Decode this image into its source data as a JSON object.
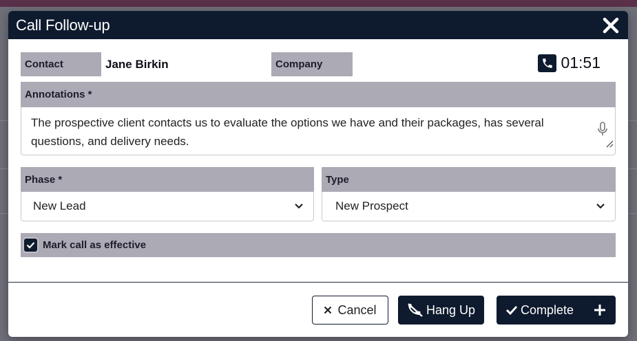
{
  "dialog": {
    "title": "Call Follow-up",
    "close_icon": "close-icon"
  },
  "contact": {
    "label": "Contact",
    "value": "Jane Birkin"
  },
  "company": {
    "label": "Company",
    "value": ""
  },
  "timer": {
    "icon": "phone-icon",
    "value": "01:51"
  },
  "annotations": {
    "label": "Annotations *",
    "value": "The prospective client contacts us to evaluate the options we have and their packages, has several questions, and delivery needs.",
    "mic_icon": "microphone-icon"
  },
  "phase": {
    "label": "Phase *",
    "selected": "New Lead"
  },
  "type": {
    "label": "Type",
    "selected": "New Prospect"
  },
  "effective": {
    "label": "Mark call as effective",
    "checked": true
  },
  "buttons": {
    "cancel": "Cancel",
    "hang_up": "Hang Up",
    "complete": "Complete"
  },
  "colors": {
    "header_bg": "#0e1a2e",
    "label_bg": "#acaab4",
    "primary_button": "#0e1a2e"
  }
}
